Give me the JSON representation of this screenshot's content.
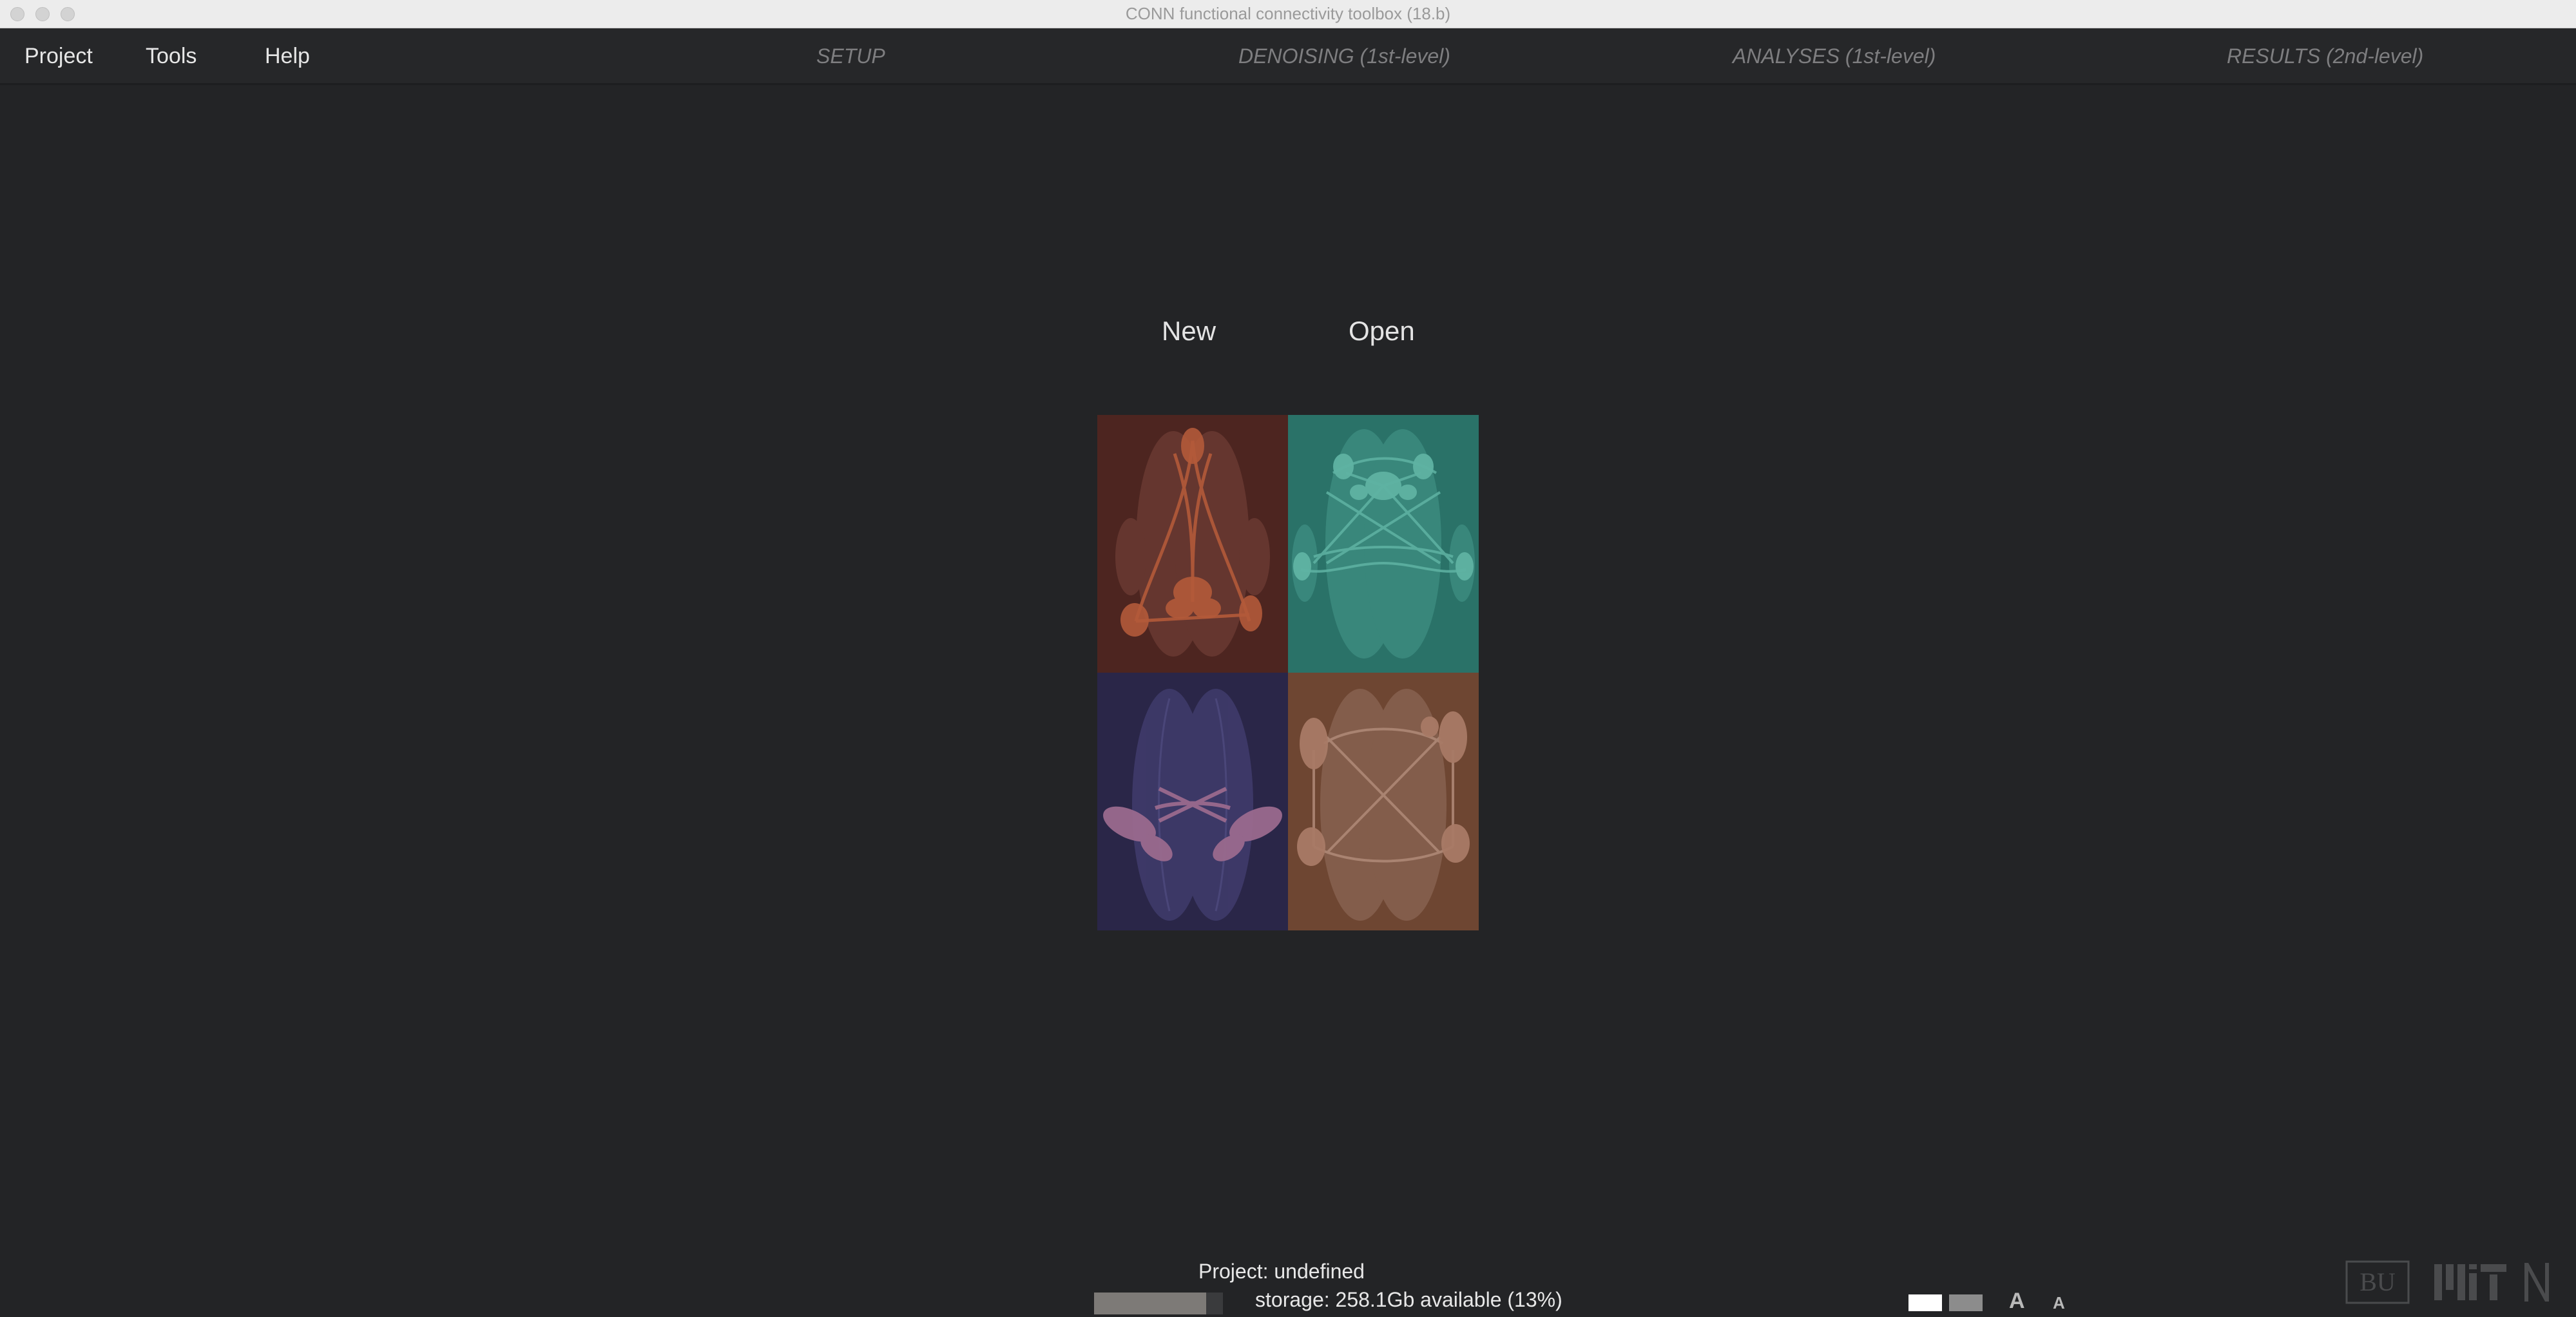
{
  "window": {
    "title": "CONN functional connectivity toolbox (18.b)"
  },
  "menu": {
    "project": "Project",
    "tools": "Tools",
    "help": "Help"
  },
  "nav": {
    "setup": "SETUP",
    "denoising": "DENOISING (1st-level)",
    "analyses": "ANALYSES (1st-level)",
    "results": "RESULTS (2nd-level)"
  },
  "main": {
    "new_label": "New",
    "open_label": "Open",
    "tiles": [
      {
        "name": "tile-top-left",
        "background": "#4d2520",
        "accent": "#b35a3a"
      },
      {
        "name": "tile-top-right",
        "background": "#2a7268",
        "accent": "#4fa394"
      },
      {
        "name": "tile-bottom-left",
        "background": "#2a2648",
        "accent": "#9a6a8e"
      },
      {
        "name": "tile-bottom-right",
        "background": "#6e4632",
        "accent": "#a87a66"
      }
    ]
  },
  "status": {
    "project": "Project: undefined",
    "storage": "storage: 258.1Gb available (13%)",
    "storage_fill_fraction": 0.87
  },
  "logos": {
    "bu": "BU",
    "mit": "MIT",
    "n": "N"
  },
  "font_controls": {
    "large": "A",
    "small": "A"
  }
}
